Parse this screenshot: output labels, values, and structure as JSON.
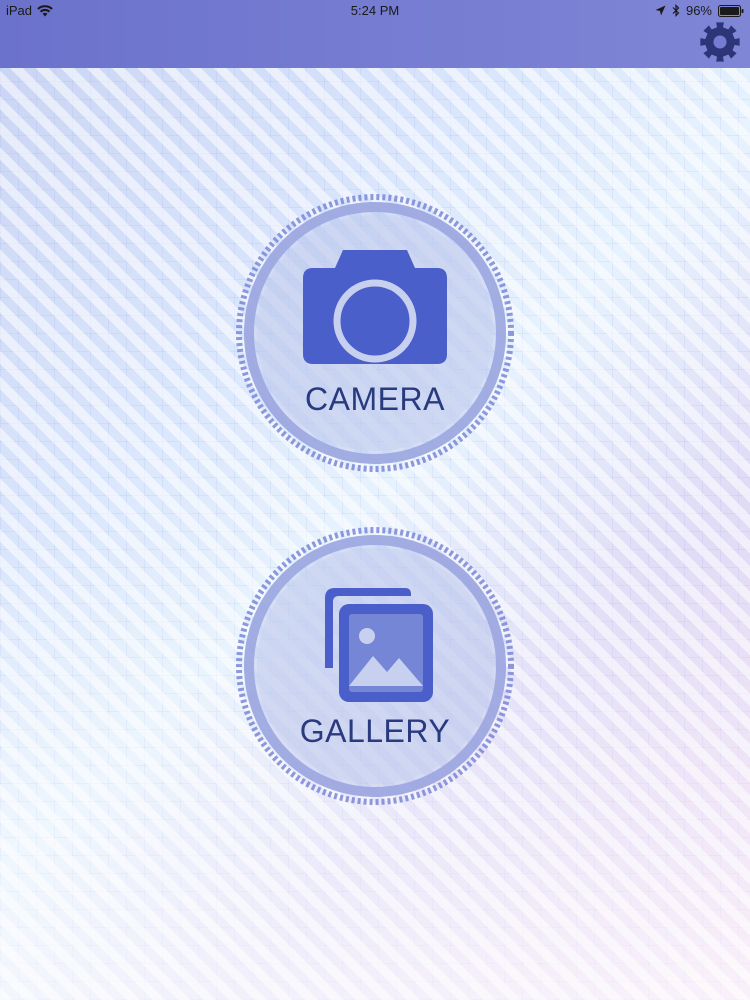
{
  "status_bar": {
    "device": "iPad",
    "time": "5:24 PM",
    "battery": "96%",
    "icons": [
      "wifi-icon",
      "location-arrow-icon",
      "bluetooth-icon",
      "battery-icon"
    ]
  },
  "header": {
    "settings_icon": "gear-icon"
  },
  "buttons": {
    "camera": {
      "label": "CAMERA",
      "icon": "camera-icon"
    },
    "gallery": {
      "label": "GALLERY",
      "icon": "gallery-icon"
    }
  },
  "colors": {
    "accent": "#4a5fc9",
    "header": "#757cd1",
    "label": "#2a3a7e",
    "gear": "#2d3478"
  }
}
